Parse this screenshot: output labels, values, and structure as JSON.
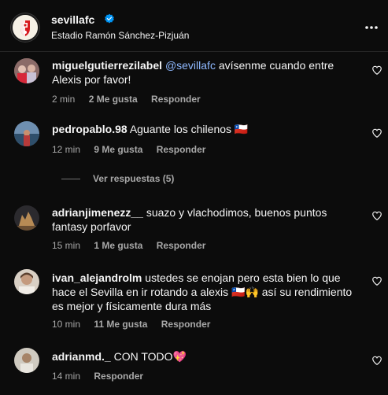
{
  "post": {
    "username": "sevillafc",
    "location": "Estadio Ramón Sánchez-Pizjuán"
  },
  "comments": [
    {
      "user": "miguelgutierrezilabel",
      "mention": "@sevillafc",
      "text": "avísenme cuando entre Alexis por favor!",
      "time": "2 min",
      "likes": "2 Me gusta",
      "reply": "Responder"
    },
    {
      "user": "pedropablo.98",
      "text": "Aguante los chilenos 🇨🇱",
      "time": "12 min",
      "likes": "9 Me gusta",
      "reply": "Responder",
      "view_replies": "Ver respuestas (5)"
    },
    {
      "user": "adrianjimenezz__",
      "text": "suazo y vlachodimos, buenos puntos fantasy porfavor",
      "time": "15 min",
      "likes": "1 Me gusta",
      "reply": "Responder"
    },
    {
      "user": "ivan_alejandrolm",
      "text": "ustedes se enojan pero esta bien lo que hace el Sevilla en ir rotando a alexis 🇨🇱🙌 así su rendimiento es mejor y físicamente dura más",
      "time": "10 min",
      "likes": "11 Me gusta",
      "reply": "Responder"
    },
    {
      "user": "adrianmd._",
      "text": "CON TODO💖",
      "time": "14 min",
      "reply": "Responder"
    }
  ],
  "colors": {
    "background": "#0c0c0c",
    "muted": "#a8a8a8",
    "accent": "#0095f6"
  }
}
